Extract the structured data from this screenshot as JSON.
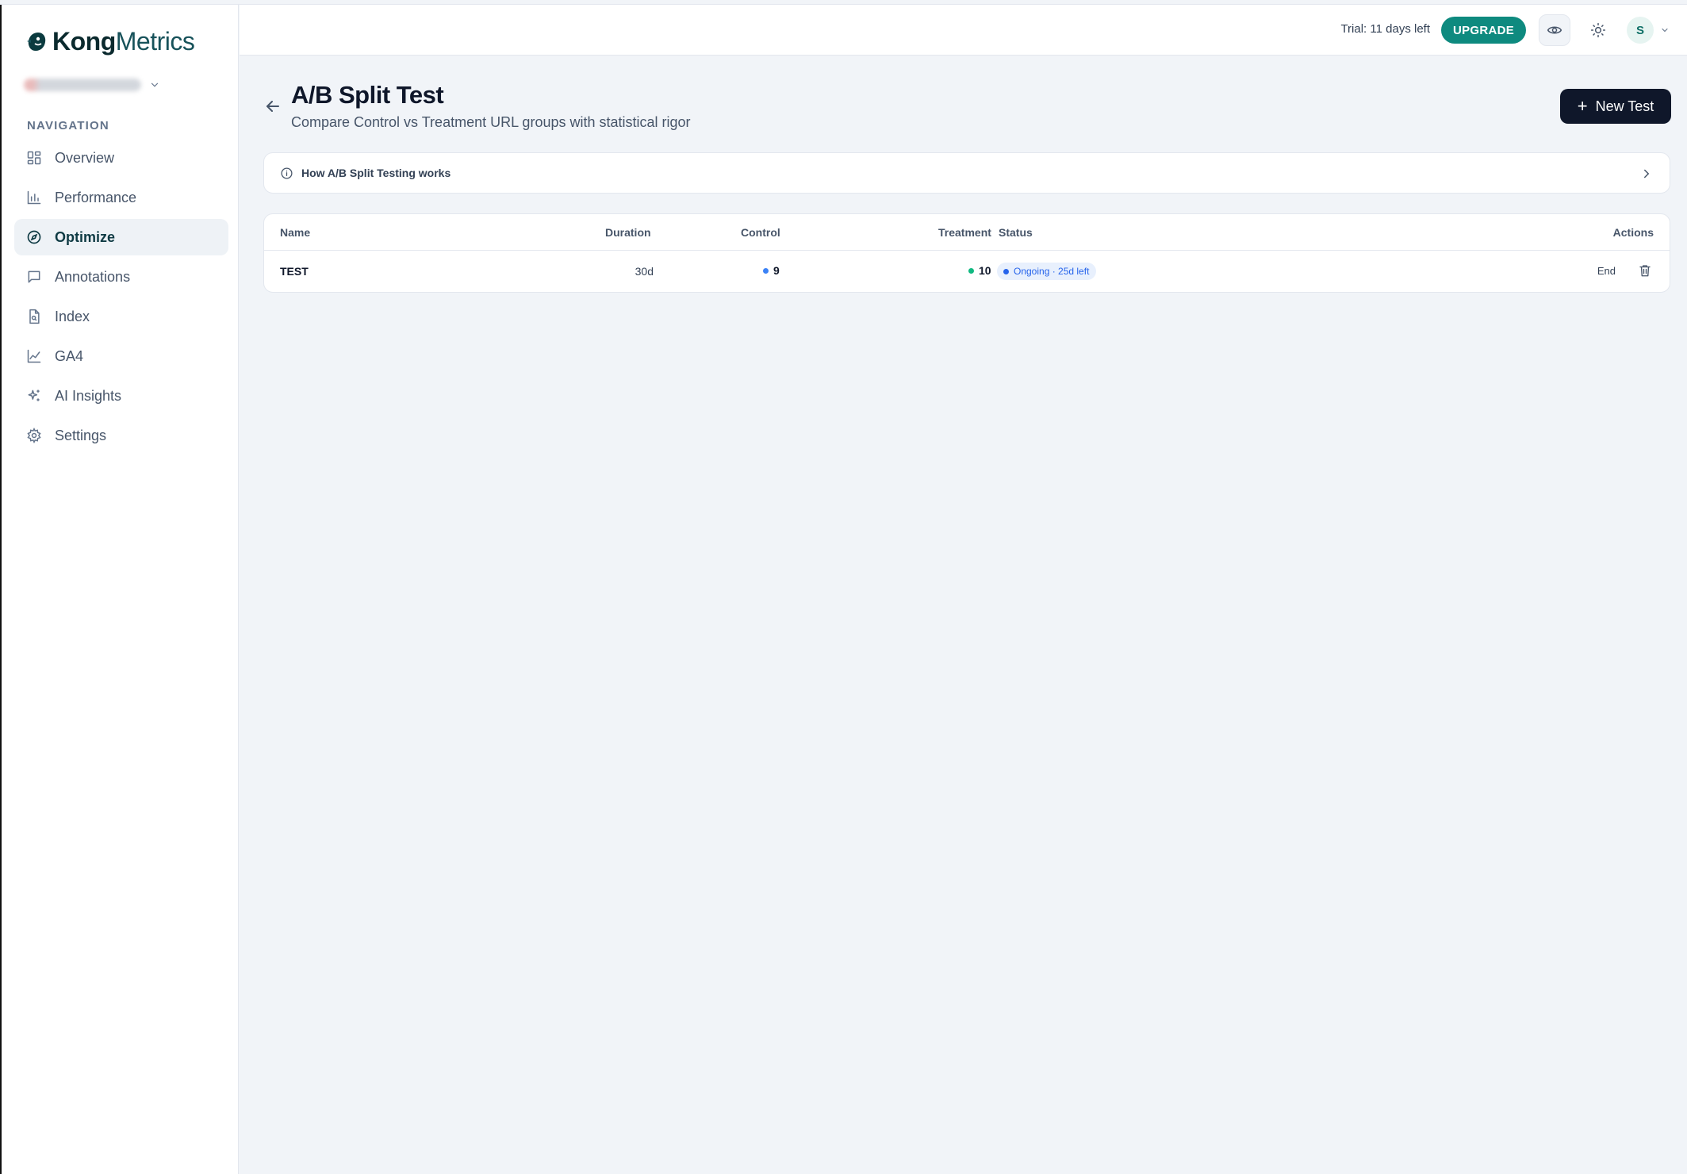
{
  "brand": {
    "name_bold": "Kong",
    "name_light": "Metrics"
  },
  "sidebar": {
    "nav_title": "NAVIGATION",
    "items": [
      {
        "label": "Overview",
        "icon": "grid-icon",
        "active": false
      },
      {
        "label": "Performance",
        "icon": "bar-chart-icon",
        "active": false
      },
      {
        "label": "Optimize",
        "icon": "compass-icon",
        "active": true
      },
      {
        "label": "Annotations",
        "icon": "message-square-icon",
        "active": false
      },
      {
        "label": "Index",
        "icon": "file-search-icon",
        "active": false
      },
      {
        "label": "GA4",
        "icon": "line-chart-icon",
        "active": false
      },
      {
        "label": "AI Insights",
        "icon": "sparkles-icon",
        "active": false
      },
      {
        "label": "Settings",
        "icon": "gear-icon",
        "active": false
      }
    ]
  },
  "topbar": {
    "trial_text": "Trial: 11 days left",
    "upgrade_label": "UPGRADE",
    "avatar_initial": "S"
  },
  "page": {
    "title": "A/B Split Test",
    "subtitle": "Compare Control vs Treatment URL groups with statistical rigor",
    "new_test_label": "New Test",
    "howto_label": "How A/B Split Testing works"
  },
  "table": {
    "headers": {
      "name": "Name",
      "duration": "Duration",
      "control": "Control",
      "treatment": "Treatment",
      "status": "Status",
      "actions": "Actions"
    },
    "rows": [
      {
        "name": "TEST",
        "duration": "30d",
        "control": "9",
        "treatment": "10",
        "status": "Ongoing · 25d left",
        "end_label": "End"
      }
    ]
  },
  "colors": {
    "accent": "#0e8a7f",
    "control_dot": "#3b82f6",
    "treatment_dot": "#10b981",
    "status_badge_bg": "#e8f0fd",
    "status_badge_text": "#2563eb"
  }
}
